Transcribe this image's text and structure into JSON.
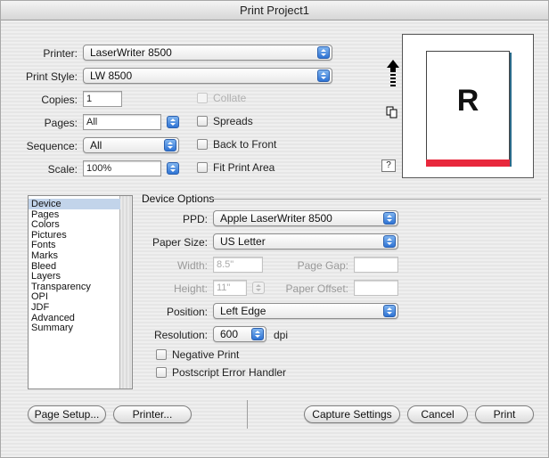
{
  "window": {
    "title": "Print Project1"
  },
  "printer": {
    "label": "Printer:",
    "value": "LaserWriter 8500"
  },
  "print_style": {
    "label": "Print Style:",
    "value": "LW 8500"
  },
  "copies": {
    "label": "Copies:",
    "value": "1"
  },
  "pages": {
    "label": "Pages:",
    "value": "All"
  },
  "sequence": {
    "label": "Sequence:",
    "value": "All"
  },
  "scale": {
    "label": "Scale:",
    "value": "100%"
  },
  "checkboxes": {
    "collate": "Collate",
    "spreads": "Spreads",
    "back_to_front": "Back to Front",
    "fit_print_area": "Fit Print Area"
  },
  "preview": {
    "letter": "R",
    "help": "?"
  },
  "panels": [
    "Device",
    "Pages",
    "Colors",
    "Pictures",
    "Fonts",
    "Marks",
    "Bleed",
    "Layers",
    "Transparency",
    "OPI",
    "JDF",
    "Advanced",
    "Summary"
  ],
  "selected_panel": "Device",
  "device_options": {
    "title": "Device Options",
    "ppd_label": "PPD:",
    "ppd_value": "Apple LaserWriter 8500",
    "paper_size_label": "Paper Size:",
    "paper_size_value": "US Letter",
    "width_label": "Width:",
    "width_value": "8.5\"",
    "page_gap_label": "Page Gap:",
    "height_label": "Height:",
    "height_value": "11\"",
    "paper_offset_label": "Paper Offset:",
    "position_label": "Position:",
    "position_value": "Left Edge",
    "resolution_label": "Resolution:",
    "resolution_value": "600",
    "resolution_unit": "dpi",
    "negative_print": "Negative Print",
    "postscript_error_handler": "Postscript Error Handler"
  },
  "buttons": {
    "page_setup": "Page Setup...",
    "printer": "Printer...",
    "capture_settings": "Capture Settings",
    "cancel": "Cancel",
    "print": "Print"
  },
  "colors": {
    "accent": "#2f74d4",
    "selection": "#c2d4ea",
    "bleed": "#e8283c"
  }
}
